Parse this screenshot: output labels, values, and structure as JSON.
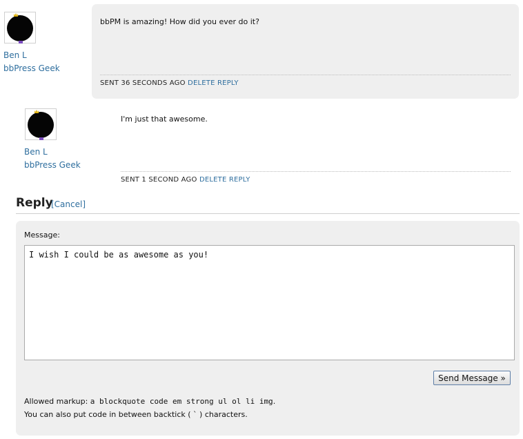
{
  "messages": [
    {
      "author": "Ben L",
      "role": "bbPress Geek",
      "text": "bbPM is amazing! How did you ever do it?",
      "sent": "SENT 36 SECONDS AGO",
      "delete_label": "DELETE",
      "reply_label": "REPLY"
    },
    {
      "author": "Ben L",
      "role": "bbPress Geek",
      "text": "I'm just that awesome.",
      "sent": "SENT 1 SECOND AGO",
      "delete_label": "DELETE",
      "reply_label": "REPLY"
    }
  ],
  "reply": {
    "title": "Reply",
    "cancel_label": "[Cancel]",
    "message_label": "Message:",
    "message_value": "I wish I could be as awesome as you!",
    "send_label": "Send Message »",
    "allowed_prefix": "Allowed markup:",
    "allowed_tags": "a blockquote code em strong ul ol li img",
    "allowed_suffix": ".",
    "backtick_note": "You can also put code in between backtick ( ` ) characters."
  },
  "colors": {
    "link": "#2e6e9e",
    "panel_bg": "#efefef"
  },
  "icons": {
    "avatar": "avatar-icon"
  }
}
